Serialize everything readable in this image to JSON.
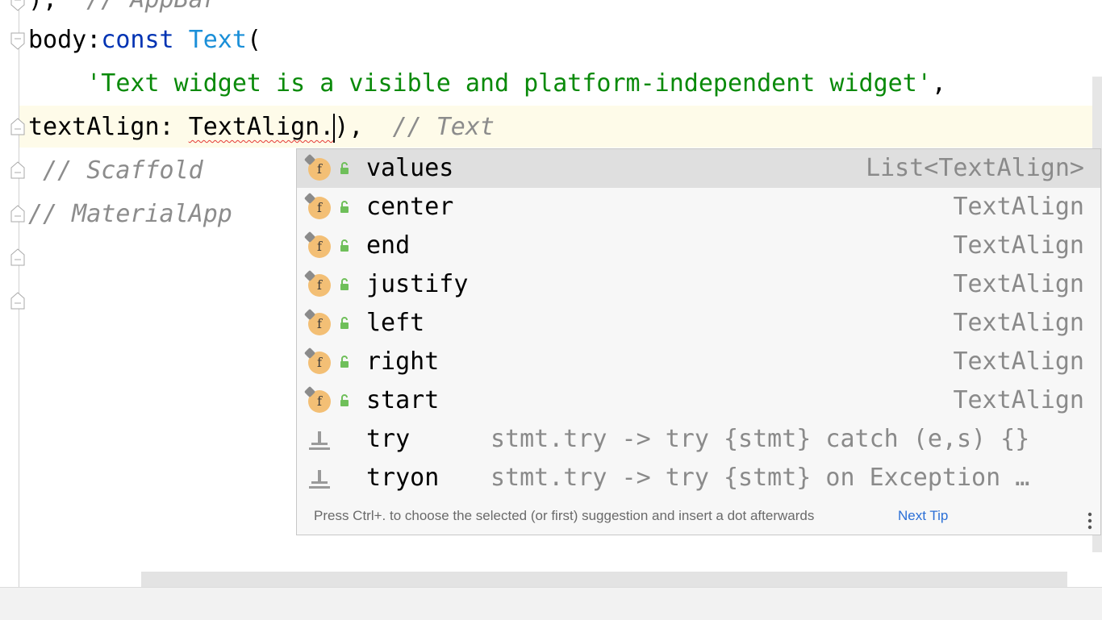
{
  "editor": {
    "lines": {
      "l0": {
        "punct": "),",
        "comment": "// AppBar"
      },
      "l1": {
        "ident": "body:",
        "keyword": "const",
        "space": " ",
        "cls": "Text",
        "paren": "("
      },
      "l2": {
        "indent": "    ",
        "string": "'Text widget is a visible and platform-independent widget'",
        "comma": ","
      },
      "l3": {
        "prop": "textAlign: ",
        "err": "TextAlign.",
        "tail": "),  ",
        "comment": "// Text"
      },
      "l4": {
        "comment": " // Scaffold"
      },
      "l5": {
        "comment": "// MaterialApp"
      }
    }
  },
  "completion": {
    "items": [
      {
        "icon": "field-icon",
        "name": "values",
        "type": "List<TextAlign>",
        "selected": true
      },
      {
        "icon": "field-icon",
        "name": "center",
        "type": "TextAlign"
      },
      {
        "icon": "field-icon",
        "name": "end",
        "type": "TextAlign"
      },
      {
        "icon": "field-icon",
        "name": "justify",
        "type": "TextAlign"
      },
      {
        "icon": "field-icon",
        "name": "left",
        "type": "TextAlign"
      },
      {
        "icon": "field-icon",
        "name": "right",
        "type": "TextAlign"
      },
      {
        "icon": "field-icon",
        "name": "start",
        "type": "TextAlign"
      },
      {
        "icon": "live-template-icon",
        "name": "try",
        "desc": "stmt.try -> try {stmt} catch (e,s) {}"
      },
      {
        "icon": "live-template-icon",
        "name": "tryon",
        "desc": "stmt.try -> try {stmt} on Exception …"
      }
    ],
    "tip": "Press Ctrl+. to choose the selected (or first) suggestion and insert a dot afterwards",
    "next_tip": "Next Tip"
  },
  "colors": {
    "keyword": "#0033b3",
    "class": "#1a8fd8",
    "string": "#0a8a0a",
    "comment": "#8c8c8c",
    "selection": "#dfdfdf",
    "caret_line": "#fefbe9"
  }
}
